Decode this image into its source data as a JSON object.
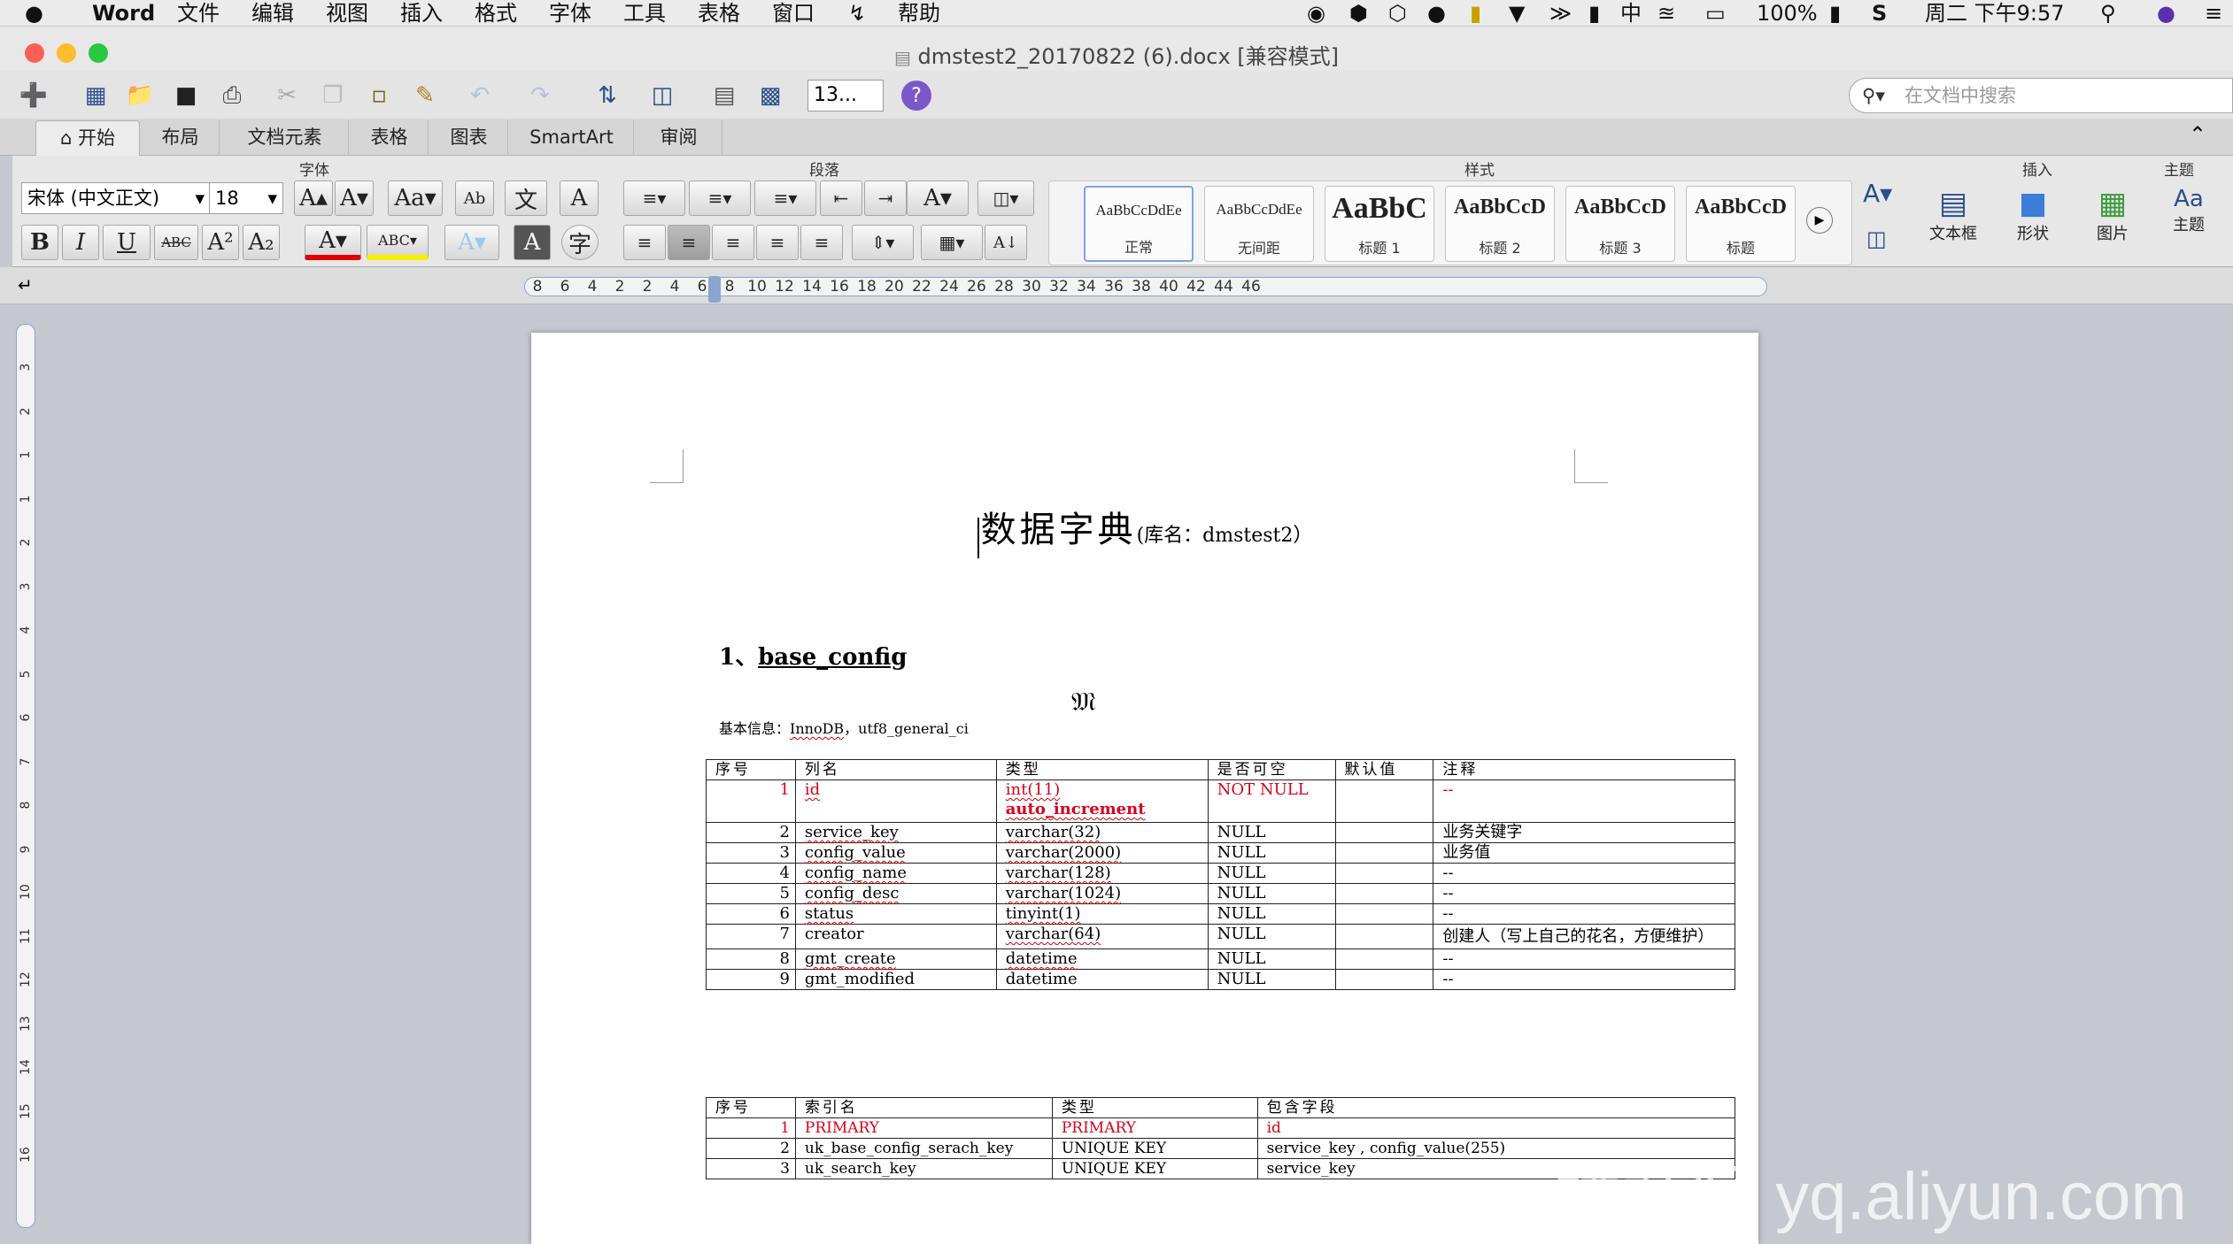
{
  "menubar": {
    "apple": "",
    "app_name": "Word",
    "items": [
      "文件",
      "编辑",
      "视图",
      "插入",
      "格式",
      "字体",
      "工具",
      "表格",
      "窗口",
      "帮助"
    ],
    "battery": "100%",
    "clock": "周二 下午9:57",
    "ime": "中"
  },
  "window": {
    "title": "dmstest2_20170822 (6).docx [兼容模式]"
  },
  "toolbar": {
    "zoom": "13...",
    "help": "?",
    "search_placeholder": "在文档中搜索"
  },
  "tabs": [
    {
      "label": "开始",
      "active": true
    },
    {
      "label": "布局"
    },
    {
      "label": "文档元素"
    },
    {
      "label": "表格"
    },
    {
      "label": "图表"
    },
    {
      "label": "SmartArt"
    },
    {
      "label": "审阅"
    }
  ],
  "ribbon": {
    "groups": {
      "font": "字体",
      "paragraph": "段落",
      "styles": "样式",
      "insert": "插入",
      "theme": "主题"
    },
    "font_name": "宋体 (中文正文)",
    "font_size": "18",
    "styles": [
      {
        "sample": "AaBbCcDdEe",
        "name": "正常"
      },
      {
        "sample": "AaBbCcDdEe",
        "name": "无间距"
      },
      {
        "sample": "AaBbC",
        "name": "标题 1"
      },
      {
        "sample": "AaBbCcD",
        "name": "标题 2"
      },
      {
        "sample": "AaBbCcD",
        "name": "标题 3"
      },
      {
        "sample": "AaBbCcD",
        "name": "标题"
      }
    ],
    "insert": {
      "textbox": "文本框",
      "shape": "形状",
      "picture": "图片"
    },
    "theme": "主题"
  },
  "ruler": {
    "numbers": [
      "8",
      "6",
      "4",
      "2",
      "2",
      "4",
      "6",
      "8",
      "10",
      "12",
      "14",
      "16",
      "18",
      "20",
      "22",
      "24",
      "26",
      "28",
      "30",
      "32",
      "34",
      "36",
      "38",
      "40",
      "42",
      "44",
      "46"
    ],
    "vnumbers": [
      "3",
      "2",
      "1",
      "1",
      "2",
      "3",
      "4",
      "5",
      "6",
      "7",
      "8",
      "9",
      "10",
      "11",
      "12",
      "13",
      "14",
      "15",
      "16"
    ]
  },
  "document": {
    "heading_main": "数据字典",
    "heading_sub": "(库名：dmstest2）",
    "section_number": "1、",
    "section_title": "base_config",
    "basic_info_label": "基本信息：",
    "basic_info_engine": "InnoDB",
    "basic_info_charset": "，utf8_general_ci",
    "columns_table": {
      "headers": [
        "序号",
        "列名",
        "类型",
        "是否可空",
        "默认值",
        "注释"
      ],
      "rows": [
        {
          "no": "1",
          "name": "id",
          "type": "int(11)",
          "type2": "auto_increment",
          "nullable": "NOT NULL",
          "default": "",
          "comment": "--",
          "pk": true
        },
        {
          "no": "2",
          "name": "service_key",
          "type": "varchar(32)",
          "nullable": "NULL",
          "default": "",
          "comment": "业务关键字"
        },
        {
          "no": "3",
          "name": "config_value",
          "type": "varchar(2000)",
          "nullable": "NULL",
          "default": "",
          "comment": "业务值"
        },
        {
          "no": "4",
          "name": "config_name",
          "type": "varchar(128)",
          "nullable": "NULL",
          "default": "",
          "comment": "--"
        },
        {
          "no": "5",
          "name": "config_desc",
          "type": "varchar(1024)",
          "nullable": "NULL",
          "default": "",
          "comment": "--"
        },
        {
          "no": "6",
          "name": "status",
          "type": "tinyint(1)",
          "nullable": "NULL",
          "default": "",
          "comment": "--"
        },
        {
          "no": "7",
          "name": "creator",
          "type": "varchar(64)",
          "nullable": "NULL",
          "default": "",
          "comment": "创建人（写上自己的花名，方便维护）"
        },
        {
          "no": "8",
          "name": "gmt_create",
          "type": "datetime",
          "nullable": "NULL",
          "default": "",
          "comment": "--"
        },
        {
          "no": "9",
          "name": "gmt_modified",
          "type": "datetime",
          "nullable": "NULL",
          "default": "",
          "comment": "--"
        }
      ]
    },
    "index_table": {
      "headers": [
        "序号",
        "索引名",
        "类型",
        "包含字段"
      ],
      "rows": [
        {
          "no": "1",
          "name": "PRIMARY",
          "type": "PRIMARY",
          "fields": "id",
          "pk": true
        },
        {
          "no": "2",
          "name": "uk_base_config_serach_key",
          "type": "UNIQUE KEY",
          "fields": "service_key , config_value(255)"
        },
        {
          "no": "3",
          "name": "uk_search_key",
          "type": "UNIQUE KEY",
          "fields": "service_key"
        }
      ]
    }
  },
  "watermark": "云栖社区 yq.aliyun.com",
  "colors": {
    "accent_blue": "#2a4f8a",
    "red": "#d9001b",
    "font_color_bar": "#e00000",
    "highlight_bar": "#f7f000"
  }
}
